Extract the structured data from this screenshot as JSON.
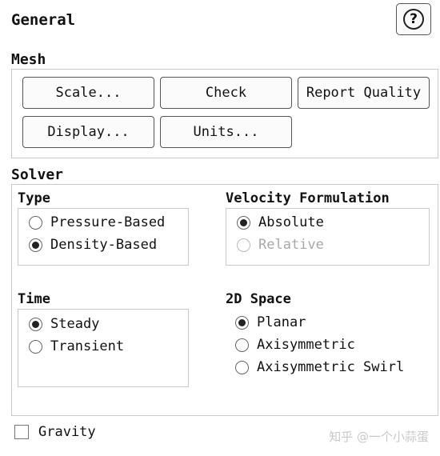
{
  "panel": {
    "title": "General"
  },
  "mesh": {
    "label": "Mesh",
    "buttons": {
      "scale": "Scale...",
      "check": "Check",
      "report_quality": "Report Quality",
      "display": "Display...",
      "units": "Units..."
    }
  },
  "solver": {
    "label": "Solver",
    "type": {
      "label": "Type",
      "options": [
        {
          "label": "Pressure-Based",
          "selected": false
        },
        {
          "label": "Density-Based",
          "selected": true
        }
      ]
    },
    "velocity": {
      "label": "Velocity Formulation",
      "options": [
        {
          "label": "Absolute",
          "selected": true
        },
        {
          "label": "Relative",
          "selected": false,
          "disabled": true
        }
      ]
    },
    "time": {
      "label": "Time",
      "options": [
        {
          "label": "Steady",
          "selected": true
        },
        {
          "label": "Transient",
          "selected": false
        }
      ]
    },
    "space": {
      "label": "2D Space",
      "options": [
        {
          "label": "Planar",
          "selected": true
        },
        {
          "label": "Axisymmetric",
          "selected": false
        },
        {
          "label": "Axisymmetric Swirl",
          "selected": false
        }
      ]
    }
  },
  "gravity": {
    "label": "Gravity",
    "checked": false
  },
  "watermark": "知乎 @一个小蒜蛋"
}
